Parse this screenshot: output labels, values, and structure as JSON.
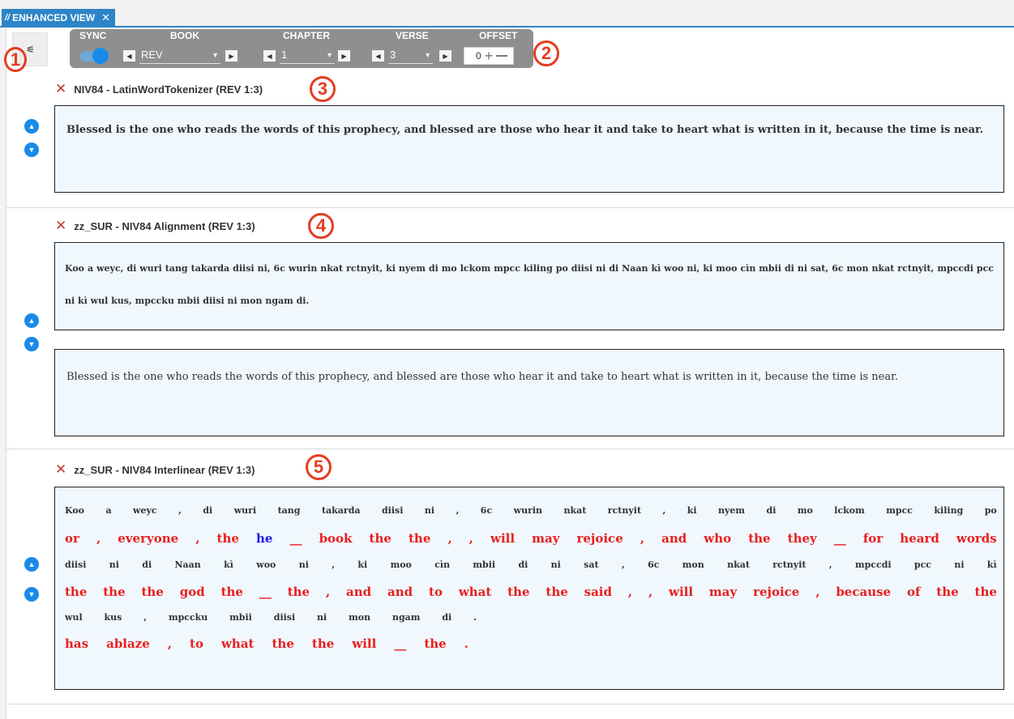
{
  "tab": {
    "glyph": "//",
    "title": "ENHANCED VIEW",
    "close": "✕"
  },
  "toolbar": {
    "settings_glyph": "⚟",
    "labels": {
      "sync": "SYNC",
      "book": "BOOK",
      "chapter": "CHAPTER",
      "verse": "VERSE",
      "offset": "OFFSET"
    },
    "sync_on": true,
    "book": "REV",
    "chapter": "1",
    "verse": "3",
    "offset": "0",
    "prev": "◀",
    "next": "▶",
    "caret": "▼",
    "plus": "+"
  },
  "annotations": [
    "1",
    "2",
    "3",
    "4",
    "5"
  ],
  "panels": [
    {
      "title": "NIV84 - LatinWordTokenizer (REV 1:3)",
      "text": "Blessed is the one who reads the words of this prophecy, and blessed are those who hear it and take to heart what is written in it, because the time is near."
    },
    {
      "title": "zz_SUR - NIV84 Alignment  (REV 1:3)",
      "source_text": "Koo a weyc, di wuri tang takarda diisi ni, 6c wurin nkat rctnyit, ki nyem di mo lckom mpcc kiling po diisi ni di Naan kì woo ni, ki moo cìn mbii di ni sat, 6c mon nkat rctnyit, mpccdi pcc ni kì wul kus, mpccku mbii diisi ni mon ngam di.",
      "target_text": "Blessed is the one who reads the words of this prophecy, and blessed are those who hear it and take to heart what is written in it, because the time is near."
    },
    {
      "title": "zz_SUR - NIV84 Interlinear  (REV 1:3)",
      "rows": [
        {
          "kind": "src",
          "words": [
            "Koo",
            "a",
            "weyc",
            ",",
            "di",
            "wuri",
            "tang",
            "takarda",
            "diisi",
            "ni",
            ",",
            "6c",
            "wurin",
            "nkat",
            "rctnyit",
            ",",
            "ki",
            "nyem",
            "di",
            "mo",
            "lckom",
            "mpcc",
            "kiling",
            "po"
          ]
        },
        {
          "kind": "gl",
          "words": [
            "or",
            ",",
            "everyone",
            ",",
            "the",
            "he",
            "__",
            "book",
            "the",
            "the",
            ",",
            ",",
            "will",
            "may",
            "rejoice",
            ",",
            "and",
            "who",
            "the",
            "they",
            "__",
            "for",
            "heard",
            "words"
          ]
        },
        {
          "kind": "src",
          "words": [
            "diisi",
            "ni",
            "di",
            "Naan",
            "kì",
            "woo",
            "ni",
            ",",
            "ki",
            "moo",
            "cìn",
            "mbii",
            "di",
            "ni",
            "sat",
            ",",
            "6c",
            "mon",
            "nkat",
            "rctnyit",
            ",",
            "mpccdi",
            "pcc",
            "ni",
            "kì"
          ]
        },
        {
          "kind": "gl",
          "words": [
            "the",
            "the",
            "the",
            "god",
            "the",
            "__",
            "the",
            ",",
            "and",
            "and",
            "to",
            "what",
            "the",
            "the",
            "said",
            ",",
            ",",
            "will",
            "may",
            "rejoice",
            ",",
            "because",
            "of",
            "the",
            "the"
          ]
        },
        {
          "kind": "src",
          "words": [
            "wul",
            "kus",
            ",",
            "mpccku",
            "mbii",
            "diisi",
            "ni",
            "mon",
            "ngam",
            "di",
            "."
          ]
        },
        {
          "kind": "gl",
          "words": [
            "has",
            "ablaze",
            ",",
            "to",
            "what",
            "the",
            "the",
            "will",
            "__",
            "the",
            "."
          ]
        }
      ],
      "blue_word": "he"
    }
  ],
  "colors": {
    "accent": "#2d84c7",
    "gloss": "#e81e1e",
    "blue_gloss": "#1a1ae8",
    "annotation": "#e43c22"
  }
}
